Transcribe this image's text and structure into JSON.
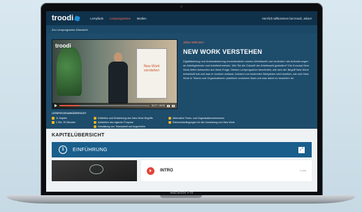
{
  "nav": {
    "brand": "troodi",
    "links": [
      "Lernpfade",
      "Lernprogramme",
      "Medien"
    ],
    "active_index": 1,
    "greeting": "Herzlich willkommen bei troodi, Julian!"
  },
  "breadcrumb": "Zur Lernprogramm-Übersicht",
  "video": {
    "logo": "troodi",
    "board_text": "New Work verstehen",
    "time": "00:27 / 02:00",
    "progress_fraction": 0.22
  },
  "course": {
    "eyebrow": "Julian Wittmann",
    "title": "NEW WORK VERSTEHEN",
    "description": "Digitalisierung und Automatisierung revolutionieren unsere Arbeitswelt und verändern die Anforderungen an Arbeitgebende und Arbeitnehmende. Wie Sie die Zukunft der Arbeitswelt gestalten? Die Konzept New Work liefert Antworten auf diese Frage. Dieses Lernprogramm beschreibt, wie sich der Begriff New Work entwickelt hat und was er konkret umfasst. Anhand von konkreten Beispielen wird deutlich, wie sich New Work in Teams und Organisationen praktisch umsetzen lässt und was dabei zu beachten ist."
  },
  "meta": {
    "heading": "LERNPROGRAMMÜBERSICHT",
    "col1": [
      "11 Kapitel",
      "1 Std. 30 Minuten"
    ],
    "col2": [
      "Definition und Entstehung des New Work Begriffs",
      "Aufstellen des eigenen Purpose",
      "Gestaltung von Teamarbeit auf Augenhöhe"
    ],
    "col3": [
      "Alternative Team- und Organisationsstrukturen",
      "Rahmenbedingungen für die Umsetzung von New Work"
    ]
  },
  "chapters": {
    "heading": "KAPITELÜBERSICHT",
    "first": {
      "number": "1",
      "label": "EINFÜHRUNG"
    },
    "lesson": {
      "title": "INTRO",
      "duration": "0 min"
    }
  },
  "device": {
    "label": "MacBook Pro"
  }
}
